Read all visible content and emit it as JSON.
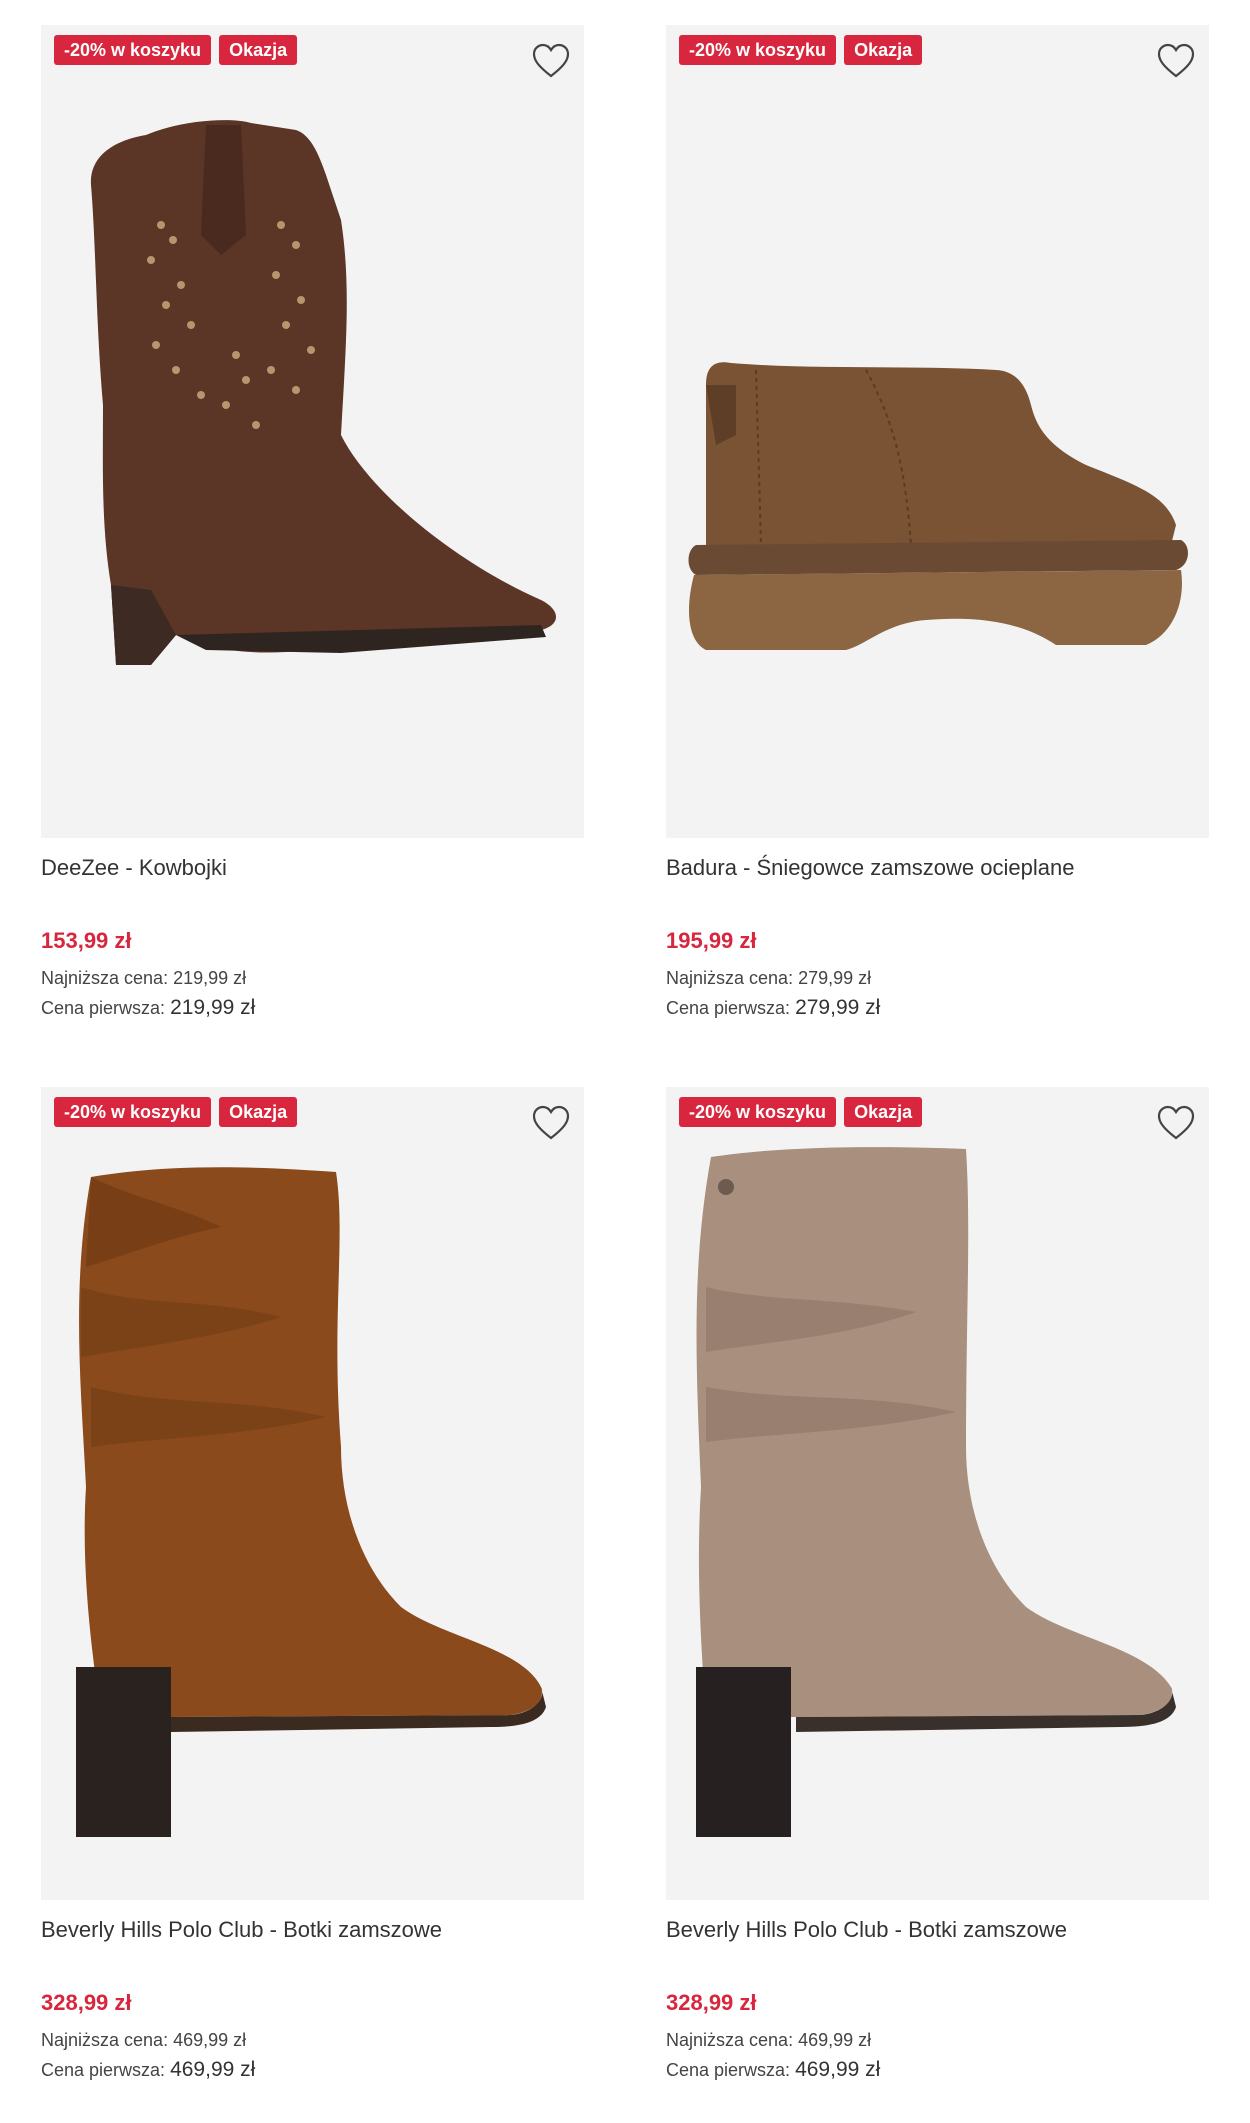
{
  "products": [
    {
      "badges": [
        "-20% w koszyku",
        "Okazja"
      ],
      "title": "DeeZee - Kowbojki",
      "price": "153,99 zł",
      "lowest_label": "Najniższa cena:",
      "lowest_value": "219,99 zł",
      "first_label": "Cena pierwsza:",
      "first_value": "219,99 zł",
      "image": "brown-suede-cowboy-boot"
    },
    {
      "badges": [
        "-20% w koszyku",
        "Okazja"
      ],
      "title": "Badura - Śniegowce zamszowe ocieplane",
      "price": "195,99 zł",
      "lowest_label": "Najniższa cena:",
      "lowest_value": "279,99 zł",
      "first_label": "Cena pierwsza:",
      "first_value": "279,99 zł",
      "image": "suede-platform-snow-boot"
    },
    {
      "badges": [
        "-20% w koszyku",
        "Okazja"
      ],
      "title": "Beverly Hills Polo Club - Botki zamszowe",
      "price": "328,99 zł",
      "lowest_label": "Najniższa cena:",
      "lowest_value": "469,99 zł",
      "first_label": "Cena pierwsza:",
      "first_value": "469,99 zł",
      "image": "cognac-slouch-heeled-boot"
    },
    {
      "badges": [
        "-20% w koszyku",
        "Okazja"
      ],
      "title": "Beverly Hills Polo Club - Botki zamszowe",
      "price": "328,99 zł",
      "lowest_label": "Najniższa cena:",
      "lowest_value": "469,99 zł",
      "first_label": "Cena pierwsza:",
      "first_value": "469,99 zł",
      "image": "taupe-slouch-heeled-boot"
    }
  ],
  "icons": {
    "favorite": "heart-outline-icon"
  },
  "colors": {
    "badge": "#d7263d",
    "price": "#d7263d",
    "image_bg": "#f3f3f3"
  }
}
